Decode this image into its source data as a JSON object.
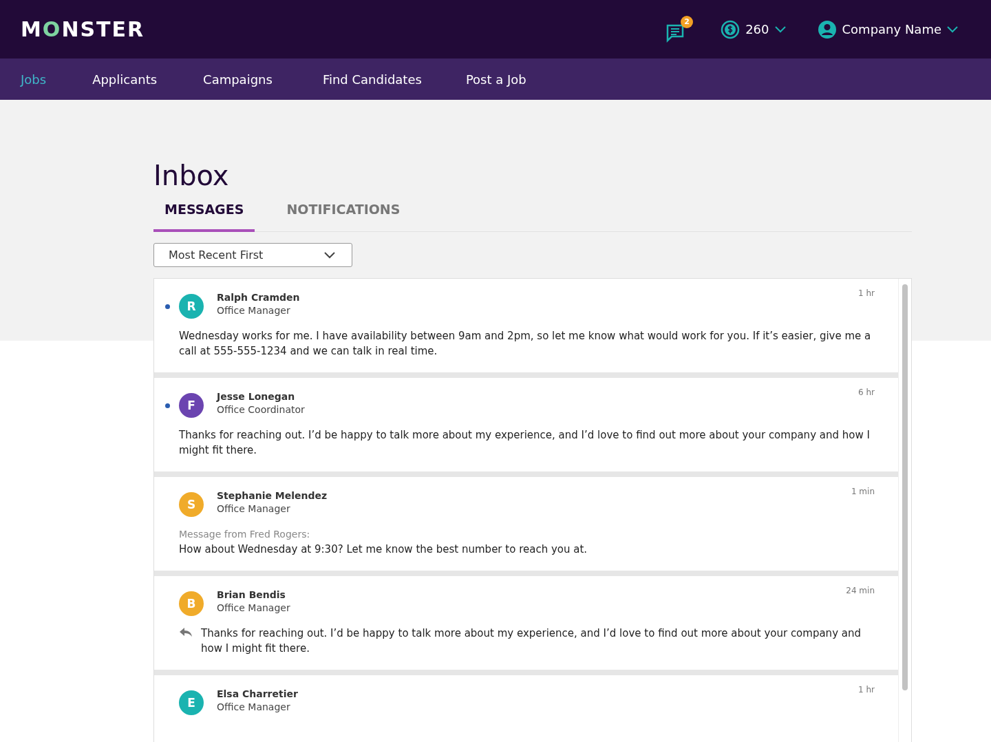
{
  "logo": [
    {
      "text": "M",
      "accent": false
    },
    {
      "text": "O",
      "accent": true
    },
    {
      "text": "NSTER",
      "accent": false
    }
  ],
  "header": {
    "message_badge": "2",
    "credits": "260",
    "account": "Company Name"
  },
  "nav": [
    {
      "label": "Jobs",
      "selected": true
    },
    {
      "label": "Applicants",
      "selected": false
    },
    {
      "label": "Campaigns",
      "selected": false
    },
    {
      "label": "Find Candidates",
      "selected": false
    },
    {
      "label": "Post a Job",
      "selected": false
    }
  ],
  "title": "Inbox",
  "tabs": [
    {
      "label": "MESSAGES",
      "selected": true
    },
    {
      "label": "NOTIFICATIONS",
      "selected": false
    }
  ],
  "sort": {
    "value": "Most Recent First"
  },
  "messages": [
    {
      "initial": "R",
      "color": "#1ab3b0",
      "name": "Ralph Cramden",
      "role": "Office Manager",
      "time": "1 hr",
      "unread": true,
      "kind": "plain",
      "body": "Wednesday works for me.  I have availability between 9am and 2pm, so let me know what would work for you. If it’s easier, give me a call at 555-555-1234 and we can talk in real time."
    },
    {
      "initial": "F",
      "color": "#6b44b0",
      "name": "Jesse Lonegan",
      "role": "Office Coordinator",
      "time": "6 hr",
      "unread": true,
      "kind": "plain",
      "body": "Thanks for reaching out. I’d be happy to talk more about my experience, and I’d love to find out more about your company and how I might fit there."
    },
    {
      "initial": "S",
      "color": "#f0ab2a",
      "name": "Stephanie Melendez",
      "role": "Office Manager",
      "time": "1 min",
      "unread": false,
      "kind": "forwarded",
      "from": "Message from Fred Rogers:",
      "body": "How about Wednesday at 9:30? Let me know the best number to reach you at."
    },
    {
      "initial": "B",
      "color": "#f0ab2a",
      "name": "Brian Bendis",
      "role": "Office Manager",
      "time": "24 min",
      "unread": false,
      "kind": "reply",
      "body": "Thanks for reaching out. I’d be happy to talk more about my experience, and I’d love to find out more about your company and how I might fit there."
    },
    {
      "initial": "E",
      "color": "#1ab3b0",
      "name": "Elsa Charretier",
      "role": "Office Manager",
      "time": "1 hr",
      "unread": false,
      "kind": "plain"
    }
  ]
}
